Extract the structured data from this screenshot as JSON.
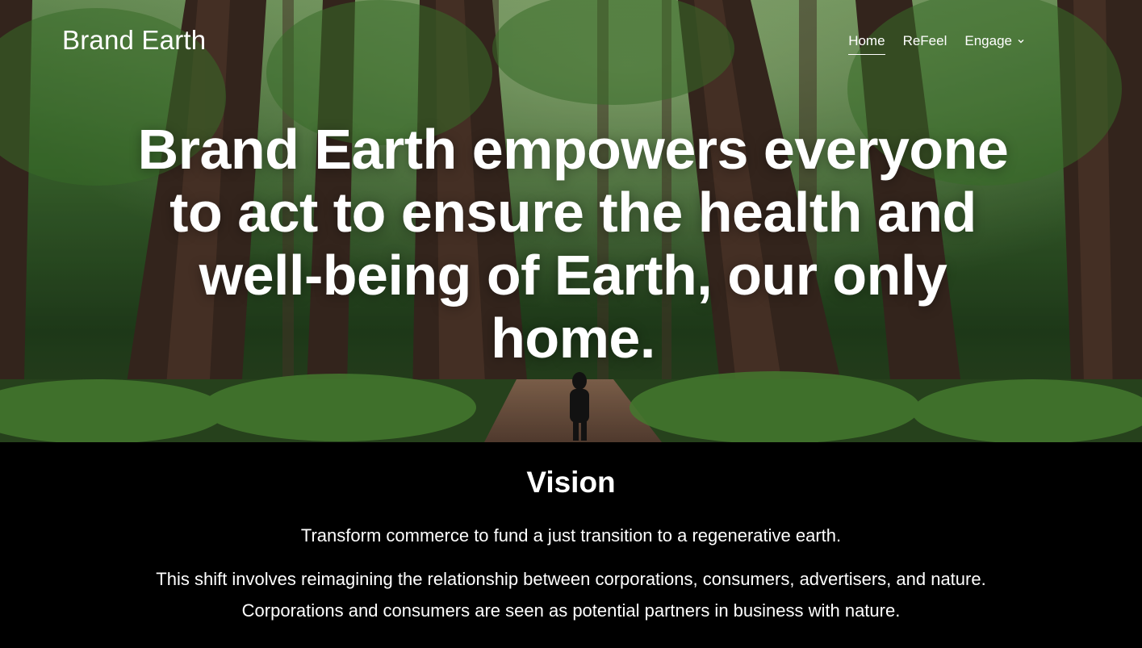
{
  "header": {
    "brand": "Brand Earth",
    "nav": [
      {
        "label": "Home",
        "active": true
      },
      {
        "label": "ReFeel",
        "active": false
      },
      {
        "label": "Engage",
        "active": false,
        "has_dropdown": true
      }
    ]
  },
  "hero": {
    "headline": "Brand Earth empowers everyone to act to ensure the health and well-being of Earth, our only home.",
    "background": "forest-photo"
  },
  "vision": {
    "title": "Vision",
    "lead": "Transform commerce to fund a just transition to a regenerative earth.",
    "body": "This shift involves reimagining the relationship between corporations, consumers, advertisers, and nature. Corporations and consumers are seen as potential partners in business with nature."
  },
  "colors": {
    "background": "#000000",
    "text": "#ffffff"
  }
}
